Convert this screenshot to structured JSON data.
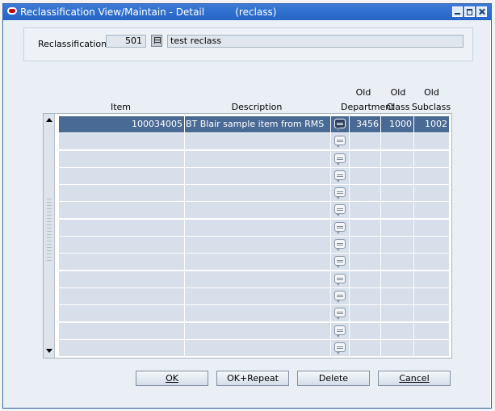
{
  "window": {
    "title": "Reclassification View/Maintain - Detail          (reclass)"
  },
  "header": {
    "reclassification_label": "Reclassification",
    "reclassification_id": "501",
    "reclassification_desc": "test reclass"
  },
  "table": {
    "columns": {
      "item": "Item",
      "description": "Description",
      "old_department": "Old Department",
      "old_class": "Old Class",
      "old_subclass": "Old Subclass"
    },
    "column_lines": {
      "old_department_top": "Old",
      "old_department_bottom": "Department",
      "old_class_top": "Old",
      "old_class_bottom": "Class",
      "old_subclass_top": "Old",
      "old_subclass_bottom": "Subclass"
    },
    "rows": [
      {
        "item": "100034005",
        "description": "BT Blair sample item from RMS",
        "old_department": "3456",
        "old_class": "1000",
        "old_subclass": "1002"
      },
      {
        "item": "",
        "description": "",
        "old_department": "",
        "old_class": "",
        "old_subclass": ""
      },
      {
        "item": "",
        "description": "",
        "old_department": "",
        "old_class": "",
        "old_subclass": ""
      },
      {
        "item": "",
        "description": "",
        "old_department": "",
        "old_class": "",
        "old_subclass": ""
      },
      {
        "item": "",
        "description": "",
        "old_department": "",
        "old_class": "",
        "old_subclass": ""
      },
      {
        "item": "",
        "description": "",
        "old_department": "",
        "old_class": "",
        "old_subclass": ""
      },
      {
        "item": "",
        "description": "",
        "old_department": "",
        "old_class": "",
        "old_subclass": ""
      },
      {
        "item": "",
        "description": "",
        "old_department": "",
        "old_class": "",
        "old_subclass": ""
      },
      {
        "item": "",
        "description": "",
        "old_department": "",
        "old_class": "",
        "old_subclass": ""
      },
      {
        "item": "",
        "description": "",
        "old_department": "",
        "old_class": "",
        "old_subclass": ""
      },
      {
        "item": "",
        "description": "",
        "old_department": "",
        "old_class": "",
        "old_subclass": ""
      },
      {
        "item": "",
        "description": "",
        "old_department": "",
        "old_class": "",
        "old_subclass": ""
      },
      {
        "item": "",
        "description": "",
        "old_department": "",
        "old_class": "",
        "old_subclass": ""
      },
      {
        "item": "",
        "description": "",
        "old_department": "",
        "old_class": "",
        "old_subclass": ""
      }
    ]
  },
  "buttons": {
    "ok": "OK",
    "ok_repeat": "OK+Repeat",
    "delete": "Delete",
    "cancel": "Cancel"
  }
}
